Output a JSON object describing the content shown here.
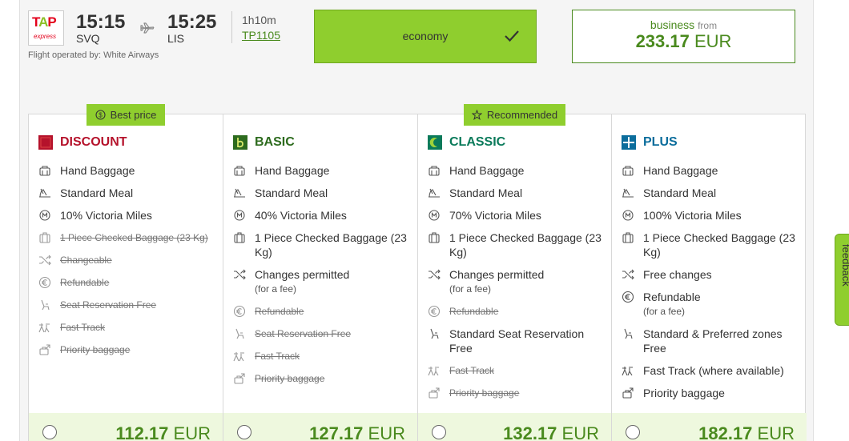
{
  "flight": {
    "logo_text_main": "TAP",
    "logo_text_sub": "express",
    "departure_time": "15:15",
    "departure_code": "SVQ",
    "arrival_time": "15:25",
    "arrival_code": "LIS",
    "duration": "1h10m",
    "flight_number": "TP1105",
    "operated_by": "Flight operated by: White Airways"
  },
  "cabins": {
    "economy_label": "economy",
    "business_label": "business",
    "business_from": "from",
    "business_price": "233.17",
    "business_currency": "EUR"
  },
  "tags": {
    "best_price": "Best price",
    "recommended": "Recommended"
  },
  "fares": [
    {
      "name": "DISCOUNT",
      "color": "#b5122b",
      "price": "112.17",
      "currency": "EUR",
      "features": [
        {
          "icon": "hand-baggage-icon",
          "text": "Hand Baggage"
        },
        {
          "icon": "meal-icon",
          "text": "Standard Meal"
        },
        {
          "icon": "miles-icon",
          "text": "10% Victoria Miles"
        },
        {
          "icon": "checked-baggage-icon",
          "text": "1 Piece Checked Baggage (23 Kg)"
        },
        {
          "icon": "change-icon",
          "text": "Changeable"
        },
        {
          "icon": "euro-icon",
          "text": "Refundable"
        },
        {
          "icon": "seat-icon",
          "text": "Seat Reservation Free"
        },
        {
          "icon": "fast-track-icon",
          "text": "Fast Track"
        },
        {
          "icon": "priority-baggage-icon",
          "text": "Priority baggage"
        }
      ]
    },
    {
      "name": "BASIC",
      "color": "#2d6b1e",
      "price": "127.17",
      "currency": "EUR",
      "features": [
        {
          "icon": "hand-baggage-icon",
          "text": "Hand Baggage"
        },
        {
          "icon": "meal-icon",
          "text": "Standard Meal"
        },
        {
          "icon": "miles-icon",
          "text": "40% Victoria Miles"
        },
        {
          "icon": "checked-baggage-icon",
          "text": "1 Piece Checked Baggage (23 Kg)"
        },
        {
          "icon": "change-icon",
          "text": "Changes permitted",
          "sub": "(for a fee)"
        },
        {
          "icon": "euro-icon",
          "text": "Refundable"
        },
        {
          "icon": "seat-icon",
          "text": "Seat Reservation Free"
        },
        {
          "icon": "fast-track-icon",
          "text": "Fast Track"
        },
        {
          "icon": "priority-baggage-icon",
          "text": "Priority baggage"
        }
      ]
    },
    {
      "name": "CLASSIC",
      "color": "#0a7a5a",
      "price": "132.17",
      "currency": "EUR",
      "features": [
        {
          "icon": "hand-baggage-icon",
          "text": "Hand Baggage"
        },
        {
          "icon": "meal-icon",
          "text": "Standard Meal"
        },
        {
          "icon": "miles-icon",
          "text": "70% Victoria Miles"
        },
        {
          "icon": "checked-baggage-icon",
          "text": "1 Piece Checked Baggage (23 Kg)"
        },
        {
          "icon": "change-icon",
          "text": "Changes permitted",
          "sub": "(for a fee)"
        },
        {
          "icon": "euro-icon",
          "text": "Refundable"
        },
        {
          "icon": "seat-icon",
          "text": "Standard Seat Reservation Free"
        },
        {
          "icon": "fast-track-icon",
          "text": "Fast Track"
        },
        {
          "icon": "priority-baggage-icon",
          "text": "Priority baggage"
        }
      ]
    },
    {
      "name": "PLUS",
      "color": "#0b6d9c",
      "price": "182.17",
      "currency": "EUR",
      "features": [
        {
          "icon": "hand-baggage-icon",
          "text": "Hand Baggage"
        },
        {
          "icon": "meal-icon",
          "text": "Standard Meal"
        },
        {
          "icon": "miles-icon",
          "text": "100% Victoria Miles"
        },
        {
          "icon": "checked-baggage-icon",
          "text": "1 Piece Checked Baggage (23 Kg)"
        },
        {
          "icon": "change-icon",
          "text": "Free changes"
        },
        {
          "icon": "euro-icon",
          "text": "Refundable",
          "sub": "(for a fee)"
        },
        {
          "icon": "seat-icon",
          "text": "Standard & Preferred zones Free"
        },
        {
          "icon": "fast-track-icon",
          "text": "Fast Track (where available)"
        },
        {
          "icon": "priority-baggage-icon",
          "text": "Priority baggage"
        }
      ]
    }
  ],
  "feedback_label": "feedback",
  "colors": {
    "accent_green": "#8fce2e",
    "price_green": "#4a8a1e",
    "selected_bg": "#eef8de"
  }
}
